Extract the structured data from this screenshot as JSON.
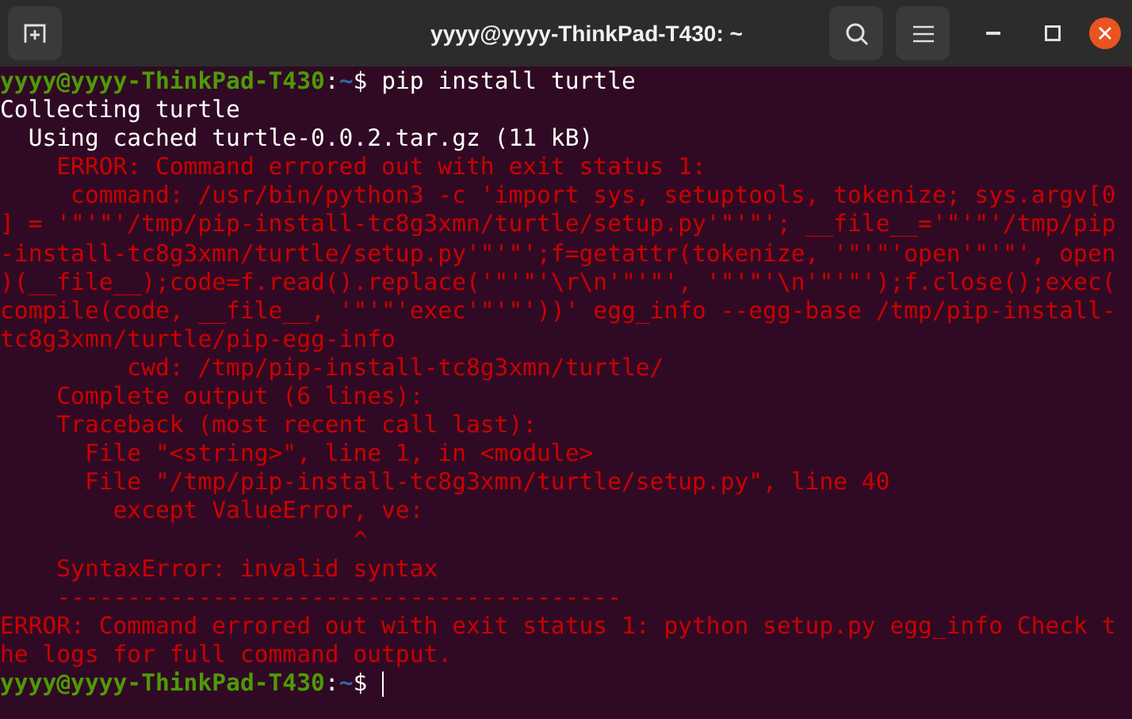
{
  "window": {
    "title": "yyyy@yyyy-ThinkPad-T430: ~"
  },
  "terminal_lines": [
    {
      "kind": "prompt",
      "user": "yyyy@yyyy-ThinkPad-T430",
      "separator": ":",
      "path": "~",
      "symbol": "$",
      "command": "pip install turtle"
    },
    {
      "kind": "output",
      "text": "Collecting turtle"
    },
    {
      "kind": "output",
      "text": "  Using cached turtle-0.0.2.tar.gz (11 kB)"
    },
    {
      "kind": "error",
      "text": "    ERROR: Command errored out with exit status 1:"
    },
    {
      "kind": "error",
      "text": "     command: /usr/bin/python3 -c 'import sys, setuptools, tokenize; sys.argv[0"
    },
    {
      "kind": "error",
      "text": "] = '\"'\"'/tmp/pip-install-tc8g3xmn/turtle/setup.py'\"'\"'; __file__='\"'\"'/tmp/pip"
    },
    {
      "kind": "error",
      "text": "-install-tc8g3xmn/turtle/setup.py'\"'\"';f=getattr(tokenize, '\"'\"'open'\"'\"', open"
    },
    {
      "kind": "error",
      "text": ")(__file__);code=f.read().replace('\"'\"'\\r\\n'\"'\"', '\"'\"'\\n'\"'\"');f.close();exec("
    },
    {
      "kind": "error",
      "text": "compile(code, __file__, '\"'\"'exec'\"'\"'))' egg_info --egg-base /tmp/pip-install-"
    },
    {
      "kind": "error",
      "text": "tc8g3xmn/turtle/pip-egg-info"
    },
    {
      "kind": "error",
      "text": "         cwd: /tmp/pip-install-tc8g3xmn/turtle/"
    },
    {
      "kind": "error",
      "text": "    Complete output (6 lines):"
    },
    {
      "kind": "error",
      "text": "    Traceback (most recent call last):"
    },
    {
      "kind": "error",
      "text": "      File \"<string>\", line 1, in <module>"
    },
    {
      "kind": "error",
      "text": "      File \"/tmp/pip-install-tc8g3xmn/turtle/setup.py\", line 40"
    },
    {
      "kind": "error",
      "text": "        except ValueError, ve:"
    },
    {
      "kind": "error",
      "text": "                         ^"
    },
    {
      "kind": "error",
      "text": "    SyntaxError: invalid syntax"
    },
    {
      "kind": "error",
      "text": "    ----------------------------------------"
    },
    {
      "kind": "error",
      "text": "ERROR: Command errored out with exit status 1: python setup.py egg_info Check t"
    },
    {
      "kind": "error",
      "text": "he logs for full command output."
    },
    {
      "kind": "prompt",
      "user": "yyyy@yyyy-ThinkPad-T430",
      "separator": ":",
      "path": "~",
      "symbol": "$",
      "cursor": true
    }
  ]
}
